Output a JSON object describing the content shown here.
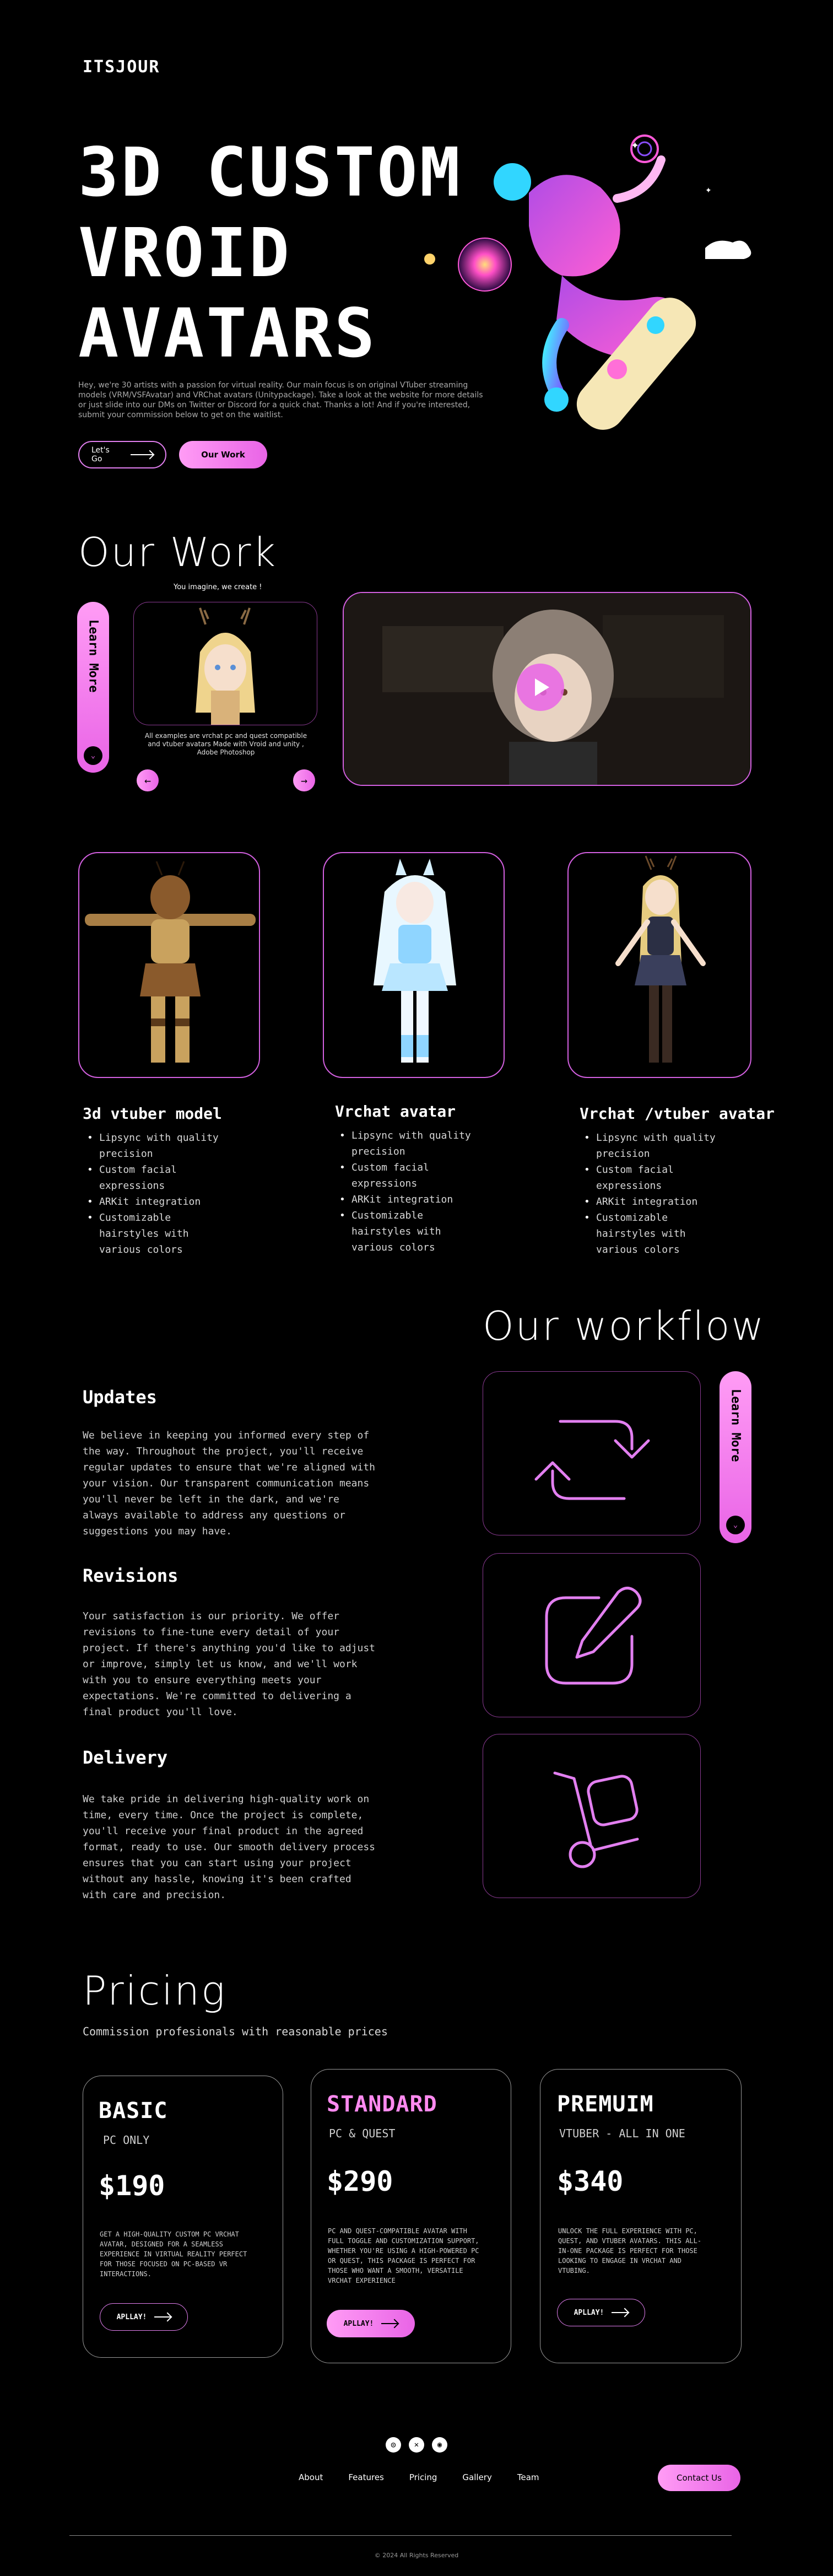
{
  "brand": {
    "logo": "ITSJOUR",
    "accent": "#e964e6",
    "accent_light": "#ff9cf5"
  },
  "hero": {
    "title_lines": [
      "3D CUSTOM",
      "VROID",
      "AVATARS"
    ],
    "description": "Hey, we're 30 artists with a passion for virtual reality. Our main focus is on original VTuber streaming models (VRM/VSFAvatar) and VRChat avatars (Unitypackage). Take a look at the website for more details or just slide into our DMs on Twitter or Discord for a quick chat. Thanks a lot! And if you're interested, submit your commission below to get on the waitlist.",
    "btn_lets_go": "Let's Go",
    "btn_our_work": "Our Work"
  },
  "our_work": {
    "title": "Our Work",
    "learn_more": "Learn More",
    "carousel_caption": "You imagine, we create !",
    "carousel_note": "All examples are vrchat pc and quest compatible and vtuber avatars Made with Vroid and unity , Adobe Photoshop",
    "prev_icon": "arrow-left-icon",
    "next_icon": "arrow-right-icon"
  },
  "models": [
    {
      "title": "3d vtuber model",
      "features": [
        "Lipsync with quality precision",
        "Custom facial expressions",
        "ARKit integration",
        "Customizable hairstyles with various colors"
      ]
    },
    {
      "title": "Vrchat avatar",
      "features": [
        "Lipsync with quality precision",
        "Custom facial expressions",
        "ARKit integration",
        "Customizable hairstyles with various colors"
      ]
    },
    {
      "title": "Vrchat /vtuber avatar",
      "features": [
        "Lipsync with quality precision",
        "Custom facial expressions",
        "ARKit integration",
        "Customizable hairstyles with various colors"
      ]
    }
  ],
  "workflow": {
    "title": "Our workflow",
    "learn_more": "Learn More",
    "steps": [
      {
        "heading": "Updates",
        "body": "We believe in keeping you informed every step of the way. Throughout the project, you'll receive regular updates to ensure that we're aligned with your vision. Our transparent communication means you'll never be left in the dark, and we're always available to address any questions or suggestions you may have.",
        "icon": "refresh-arrows-icon"
      },
      {
        "heading": "Revisions",
        "body": "Your satisfaction is our priority. We offer revisions to fine-tune every detail of your project. If there's anything you'd like to adjust or improve, simply let us know, and we'll work with you to ensure everything meets your expectations. We're committed to delivering a final product you'll love.",
        "icon": "edit-pencil-icon"
      },
      {
        "heading": "Delivery",
        "body": "We take pride in delivering high-quality work on time, every time. Once the project is complete, you'll receive your final product in the agreed format, ready to use. Our smooth delivery process ensures that you can start using your project without any hassle, knowing it's been crafted with care and precision.",
        "icon": "hand-truck-icon"
      }
    ]
  },
  "pricing": {
    "title": "Pricing",
    "subtitle": "Commission profesionals with reasonable prices",
    "plans": [
      {
        "name": "BASIC",
        "sub": "PC ONLY",
        "price": "$190",
        "desc": "GET A HIGH-QUALITY CUSTOM PC VRCHAT AVATAR, DESIGNED FOR A SEAMLESS EXPERIENCE IN VIRTUAL REALITY PERFECT FOR THOSE FOCUSED ON PC-BASED VR INTERACTIONS.",
        "cta": "APLLAY!"
      },
      {
        "name": "STANDARD",
        "sub": "PC & QUEST",
        "price": "$290",
        "desc": "PC AND QUEST-COMPATIBLE AVATAR WITH FULL TOGGLE AND CUSTOMIZATION SUPPORT, WHETHER YOU'RE USING A HIGH-POWERED PC OR QUEST, THIS PACKAGE IS PERFECT FOR THOSE WHO WANT A SMOOTH, VERSATILE VRCHAT EXPERIENCE",
        "cta": "APLLAY!"
      },
      {
        "name": "PREMUIM",
        "sub": "VTUBER - ALL IN ONE",
        "price": "$340",
        "desc": "UNLOCK THE FULL EXPERIENCE WITH PC, QUEST, AND VTUBER AVATARS. THIS ALL-IN-ONE PACKAGE IS PERFECT FOR THOSE LOOKING TO ENGAGE IN VRCHAT AND VTUBING.",
        "cta": "APLLAY!"
      }
    ]
  },
  "footer": {
    "social_icons": [
      "discord-icon",
      "twitter-icon",
      "instagram-icon"
    ],
    "links": [
      "About",
      "Features",
      "Pricing",
      "Gallery",
      "Team"
    ],
    "contact": "Contact Us",
    "copyright": "© 2024 All Rights Reserved"
  }
}
